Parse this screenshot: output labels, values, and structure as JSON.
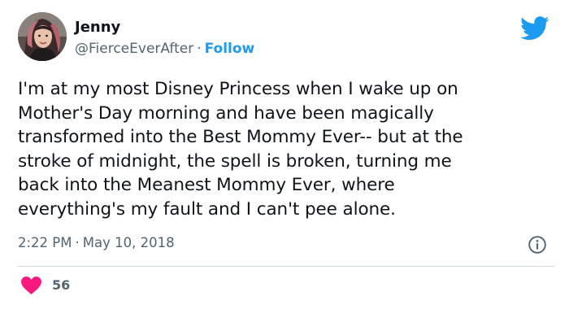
{
  "author": {
    "display_name": "Jenny",
    "handle": "@FierceEverAfter",
    "separator": "·",
    "follow_label": "Follow"
  },
  "tweet": {
    "text": "I'm at my most Disney Princess when I wake up on\nMother's Day morning and have been magically\ntransformed into the Best Mommy Ever-- but at the\nstroke of midnight, the spell is broken, turning me\nback into the Meanest Mommy Ever, where\neverything's my fault and I can't pee alone.",
    "time": "2:22 PM",
    "separator": "·",
    "date": "May 10, 2018"
  },
  "engagement": {
    "likes": "56"
  },
  "icons": {
    "brand": "twitter-bird-icon",
    "info": "info-icon",
    "like": "heart-icon",
    "avatar": "avatar"
  },
  "colors": {
    "brand": "#1d9bf0",
    "text_primary": "#0f1419",
    "text_secondary": "#536471",
    "divider": "#cfd9de",
    "like": "#f91880"
  }
}
